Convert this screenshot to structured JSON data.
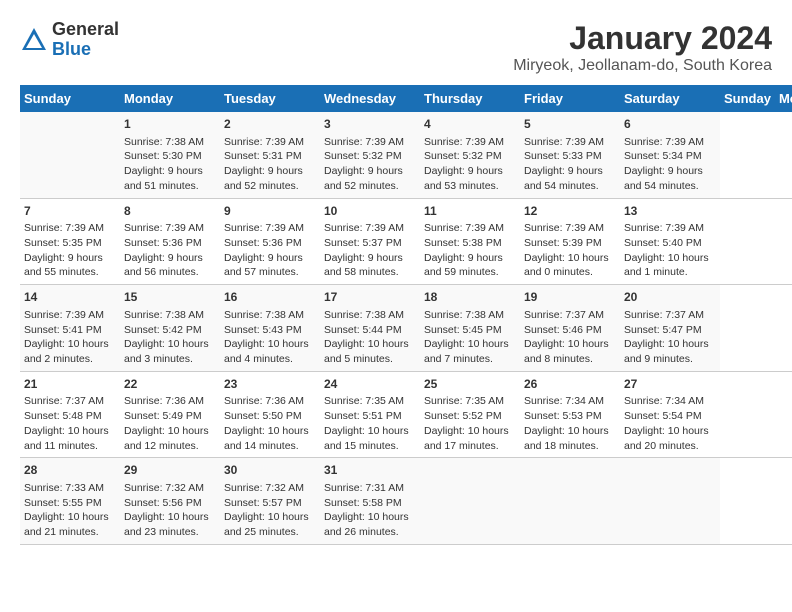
{
  "header": {
    "logo_line1": "General",
    "logo_line2": "Blue",
    "title": "January 2024",
    "subtitle": "Miryeok, Jeollanam-do, South Korea"
  },
  "days_of_week": [
    "Sunday",
    "Monday",
    "Tuesday",
    "Wednesday",
    "Thursday",
    "Friday",
    "Saturday"
  ],
  "weeks": [
    [
      {
        "day": "",
        "content": ""
      },
      {
        "day": "1",
        "content": "Sunrise: 7:38 AM\nSunset: 5:30 PM\nDaylight: 9 hours\nand 51 minutes."
      },
      {
        "day": "2",
        "content": "Sunrise: 7:39 AM\nSunset: 5:31 PM\nDaylight: 9 hours\nand 52 minutes."
      },
      {
        "day": "3",
        "content": "Sunrise: 7:39 AM\nSunset: 5:32 PM\nDaylight: 9 hours\nand 52 minutes."
      },
      {
        "day": "4",
        "content": "Sunrise: 7:39 AM\nSunset: 5:32 PM\nDaylight: 9 hours\nand 53 minutes."
      },
      {
        "day": "5",
        "content": "Sunrise: 7:39 AM\nSunset: 5:33 PM\nDaylight: 9 hours\nand 54 minutes."
      },
      {
        "day": "6",
        "content": "Sunrise: 7:39 AM\nSunset: 5:34 PM\nDaylight: 9 hours\nand 54 minutes."
      }
    ],
    [
      {
        "day": "7",
        "content": "Sunrise: 7:39 AM\nSunset: 5:35 PM\nDaylight: 9 hours\nand 55 minutes."
      },
      {
        "day": "8",
        "content": "Sunrise: 7:39 AM\nSunset: 5:36 PM\nDaylight: 9 hours\nand 56 minutes."
      },
      {
        "day": "9",
        "content": "Sunrise: 7:39 AM\nSunset: 5:36 PM\nDaylight: 9 hours\nand 57 minutes."
      },
      {
        "day": "10",
        "content": "Sunrise: 7:39 AM\nSunset: 5:37 PM\nDaylight: 9 hours\nand 58 minutes."
      },
      {
        "day": "11",
        "content": "Sunrise: 7:39 AM\nSunset: 5:38 PM\nDaylight: 9 hours\nand 59 minutes."
      },
      {
        "day": "12",
        "content": "Sunrise: 7:39 AM\nSunset: 5:39 PM\nDaylight: 10 hours\nand 0 minutes."
      },
      {
        "day": "13",
        "content": "Sunrise: 7:39 AM\nSunset: 5:40 PM\nDaylight: 10 hours\nand 1 minute."
      }
    ],
    [
      {
        "day": "14",
        "content": "Sunrise: 7:39 AM\nSunset: 5:41 PM\nDaylight: 10 hours\nand 2 minutes."
      },
      {
        "day": "15",
        "content": "Sunrise: 7:38 AM\nSunset: 5:42 PM\nDaylight: 10 hours\nand 3 minutes."
      },
      {
        "day": "16",
        "content": "Sunrise: 7:38 AM\nSunset: 5:43 PM\nDaylight: 10 hours\nand 4 minutes."
      },
      {
        "day": "17",
        "content": "Sunrise: 7:38 AM\nSunset: 5:44 PM\nDaylight: 10 hours\nand 5 minutes."
      },
      {
        "day": "18",
        "content": "Sunrise: 7:38 AM\nSunset: 5:45 PM\nDaylight: 10 hours\nand 7 minutes."
      },
      {
        "day": "19",
        "content": "Sunrise: 7:37 AM\nSunset: 5:46 PM\nDaylight: 10 hours\nand 8 minutes."
      },
      {
        "day": "20",
        "content": "Sunrise: 7:37 AM\nSunset: 5:47 PM\nDaylight: 10 hours\nand 9 minutes."
      }
    ],
    [
      {
        "day": "21",
        "content": "Sunrise: 7:37 AM\nSunset: 5:48 PM\nDaylight: 10 hours\nand 11 minutes."
      },
      {
        "day": "22",
        "content": "Sunrise: 7:36 AM\nSunset: 5:49 PM\nDaylight: 10 hours\nand 12 minutes."
      },
      {
        "day": "23",
        "content": "Sunrise: 7:36 AM\nSunset: 5:50 PM\nDaylight: 10 hours\nand 14 minutes."
      },
      {
        "day": "24",
        "content": "Sunrise: 7:35 AM\nSunset: 5:51 PM\nDaylight: 10 hours\nand 15 minutes."
      },
      {
        "day": "25",
        "content": "Sunrise: 7:35 AM\nSunset: 5:52 PM\nDaylight: 10 hours\nand 17 minutes."
      },
      {
        "day": "26",
        "content": "Sunrise: 7:34 AM\nSunset: 5:53 PM\nDaylight: 10 hours\nand 18 minutes."
      },
      {
        "day": "27",
        "content": "Sunrise: 7:34 AM\nSunset: 5:54 PM\nDaylight: 10 hours\nand 20 minutes."
      }
    ],
    [
      {
        "day": "28",
        "content": "Sunrise: 7:33 AM\nSunset: 5:55 PM\nDaylight: 10 hours\nand 21 minutes."
      },
      {
        "day": "29",
        "content": "Sunrise: 7:32 AM\nSunset: 5:56 PM\nDaylight: 10 hours\nand 23 minutes."
      },
      {
        "day": "30",
        "content": "Sunrise: 7:32 AM\nSunset: 5:57 PM\nDaylight: 10 hours\nand 25 minutes."
      },
      {
        "day": "31",
        "content": "Sunrise: 7:31 AM\nSunset: 5:58 PM\nDaylight: 10 hours\nand 26 minutes."
      },
      {
        "day": "",
        "content": ""
      },
      {
        "day": "",
        "content": ""
      },
      {
        "day": "",
        "content": ""
      }
    ]
  ]
}
